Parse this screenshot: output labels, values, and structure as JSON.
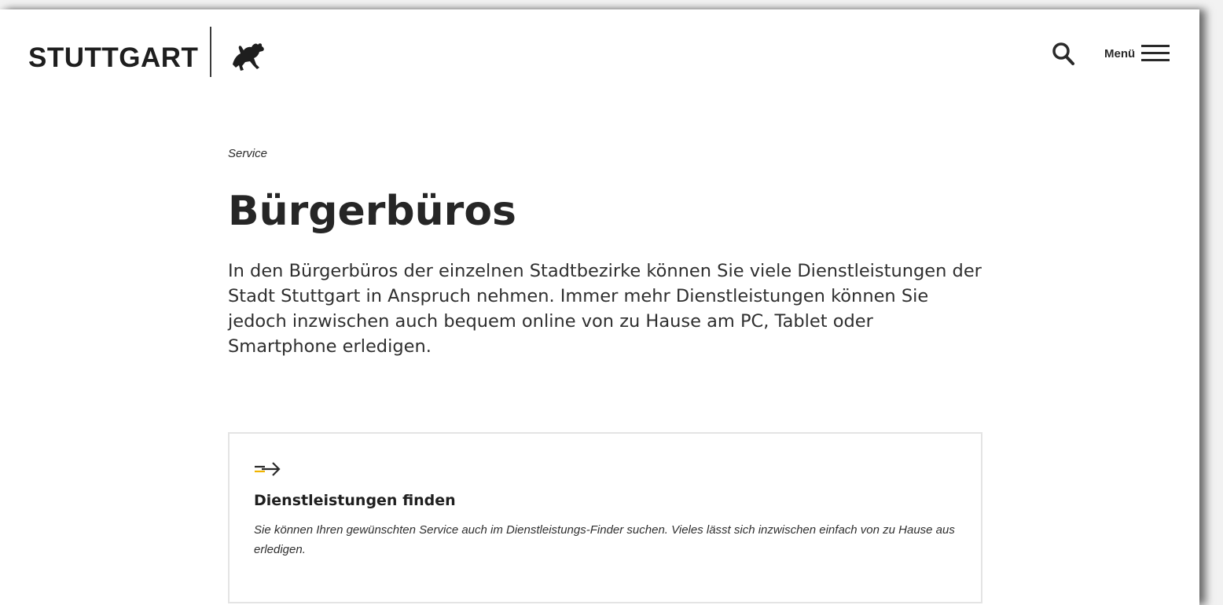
{
  "header": {
    "logo_text": "STUTTGART",
    "logo_icon": "stuttgart-horse-icon",
    "search_icon": "search-icon",
    "menu_label": "Menü",
    "menu_icon": "hamburger-icon"
  },
  "main": {
    "breadcrumb": "Service",
    "title": "Bürgerbüros",
    "intro": "In den Bürgerbüros der einzelnen Stadtbezirke können Sie viele Dienstleistungen der Stadt Stuttgart in Anspruch nehmen. Immer mehr Dienstleistungen können Sie jedoch inzwischen auch bequem online von zu Hause am PC, Tablet oder Smartphone erledigen."
  },
  "card": {
    "icon": "arrow-right-icon",
    "title": "Dienstleistungen finden",
    "text": "Sie können Ihren gewünschten Service auch im Dienstleistungs-Finder suchen. Vieles lässt sich inzwischen einfach von zu Hause aus erledigen."
  },
  "colors": {
    "accent": "#f0b400",
    "text": "#2a2a2a",
    "card_border": "#e4e4e4"
  }
}
